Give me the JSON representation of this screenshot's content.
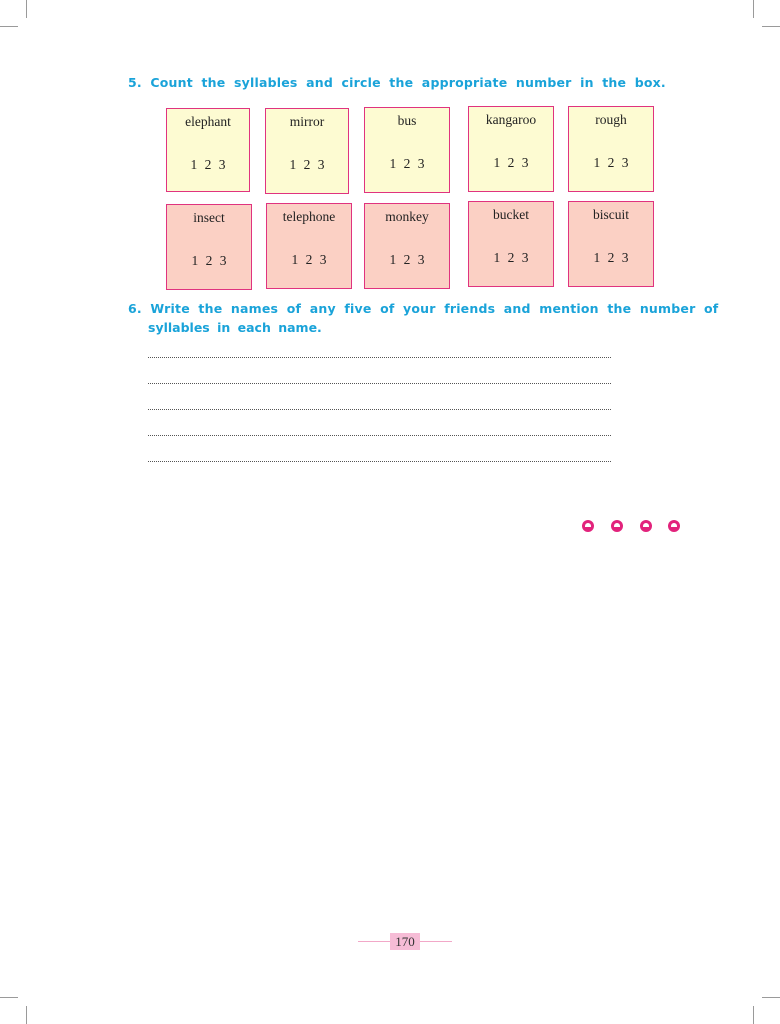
{
  "q5": {
    "title": "5. Count the syllables and circle the appropriate number in the box.",
    "cards": [
      {
        "word": "elephant",
        "nums": "1 2 3",
        "color": "#fdfbd2"
      },
      {
        "word": "mirror",
        "nums": "1 2 3",
        "color": "#fdfbd2"
      },
      {
        "word": "bus",
        "nums": "1 2 3",
        "color": "#fdfbd2"
      },
      {
        "word": "kangaroo",
        "nums": "1 2 3",
        "color": "#fdfbd2"
      },
      {
        "word": "rough",
        "nums": "1 2 3",
        "color": "#fdfbd2"
      },
      {
        "word": "insect",
        "nums": "1 2 3",
        "color": "#fbd0c4"
      },
      {
        "word": "telephone",
        "nums": "1 2 3",
        "color": "#fbd0c4"
      },
      {
        "word": "monkey",
        "nums": "1 2 3",
        "color": "#fbd0c4"
      },
      {
        "word": "bucket",
        "nums": "1 2 3",
        "color": "#fbd0c4"
      },
      {
        "word": "biscuit",
        "nums": "1 2 3",
        "color": "#fbd0c4"
      }
    ]
  },
  "q6": {
    "line1": "6. Write the names of any five of your friends and mention the number of",
    "line2": "syllables in each name."
  },
  "page_number": "170",
  "colors": {
    "accent": "#1aa3d9",
    "border": "#e0337f",
    "dots": "#e2237c"
  }
}
